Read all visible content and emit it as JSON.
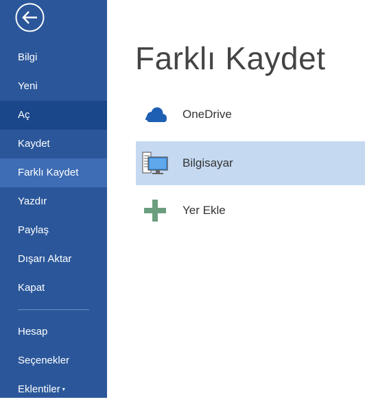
{
  "sidebar": {
    "back_label": "",
    "items": [
      {
        "label": "Bilgi"
      },
      {
        "label": "Yeni"
      },
      {
        "label": "Aç"
      },
      {
        "label": "Kaydet"
      },
      {
        "label": "Farklı Kaydet"
      },
      {
        "label": "Yazdır"
      },
      {
        "label": "Paylaş"
      },
      {
        "label": "Dışarı Aktar"
      },
      {
        "label": "Kapat"
      }
    ],
    "bottom_items": [
      {
        "label": "Hesap"
      },
      {
        "label": "Seçenekler"
      },
      {
        "label": "Eklentiler"
      }
    ],
    "add_ins_caret": "▾"
  },
  "main": {
    "title": "Farklı Kaydet",
    "places": [
      {
        "label": "OneDrive",
        "icon": "cloud-icon"
      },
      {
        "label": "Bilgisayar",
        "icon": "computer-icon",
        "selected": true
      },
      {
        "label": "Yer Ekle",
        "icon": "plus-icon"
      }
    ]
  },
  "colors": {
    "sidebar_bg": "#2b579a",
    "sidebar_selected": "#19478a",
    "sidebar_active": "#3e6db5",
    "place_selected": "#c5d9f1",
    "onedrive_blue": "#1e5fb4",
    "add_green": "#6b9e7e"
  }
}
